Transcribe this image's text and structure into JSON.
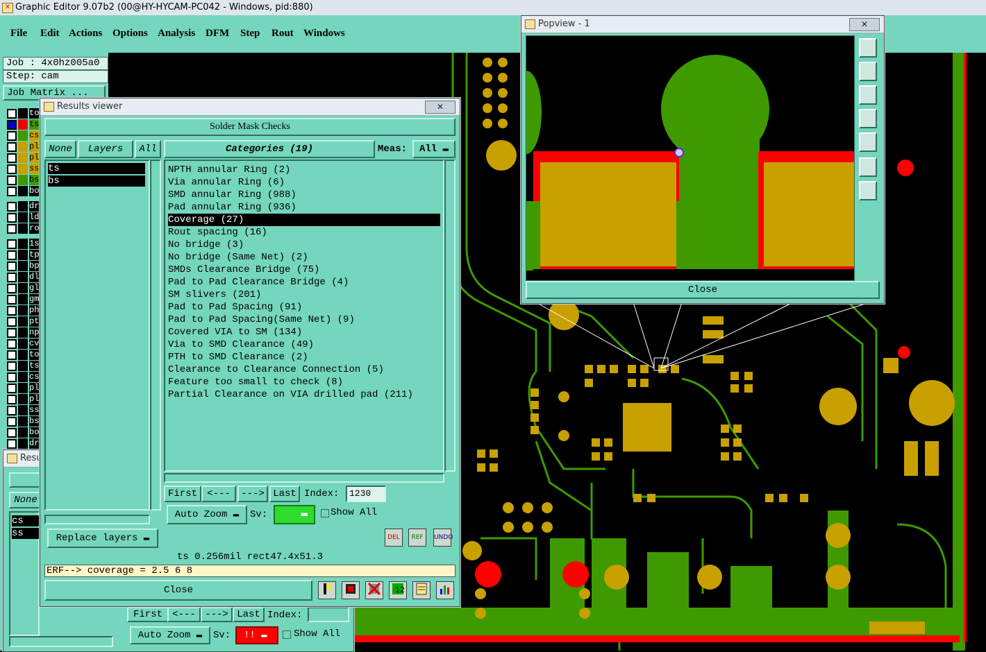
{
  "window": {
    "title": "Graphic Editor 9.07b2 (00@HY-HYCAM-PC042 - Windows, pid:880)"
  },
  "menu": [
    "File",
    "Edit",
    "Actions",
    "Options",
    "Analysis",
    "DFM",
    "Step",
    "Rout",
    "Windows"
  ],
  "job": {
    "job_label": "Job : 4x0hz005a0",
    "step_label": "Step: cam",
    "matrix_button": "Job Matrix ..."
  },
  "layers": [
    "to",
    "ts",
    "cs",
    "pl",
    "pl",
    "ss",
    "bs",
    "bo",
    "dr",
    "ld",
    "ro",
    "1s",
    "tp",
    "bp",
    "dl",
    "gl",
    "gm",
    "ph",
    "pt",
    "np",
    "cv",
    "to",
    "ts",
    "cs",
    "pl",
    "pl",
    "ss",
    "bs",
    "bo",
    "dr"
  ],
  "results_viewer": {
    "title": "Results viewer",
    "header": "Solder Mask Checks",
    "none_btn": "None",
    "layers_btn": "Layers",
    "all_btn": "All",
    "categories_label": "Categories (19)",
    "meas_label": "Meas:",
    "meas_value": "All",
    "layer_list": [
      "ts",
      "bs"
    ],
    "categories": [
      "NPTH annular Ring (2)",
      "Via annular Ring (6)",
      "SMD annular Ring (988)",
      "Pad annular Ring (936)",
      "Coverage (27)",
      "Rout spacing (16)",
      "No bridge (3)",
      "No bridge (Same Net) (2)",
      "SMDs Clearance Bridge (75)",
      "Pad to Pad Clearance Bridge (4)",
      "SM slivers (201)",
      "Pad to Pad Spacing (91)",
      "Pad to Pad Spacing(Same Net) (9)",
      "Covered VIA to SM (134)",
      "Via to SMD Clearance (49)",
      "PTH to SMD Clearance (2)",
      "Clearance to Clearance Connection (5)",
      "Feature too small to check (8)",
      "Partial Clearance on VIA drilled pad (211)"
    ],
    "selected_index": 4,
    "nav": {
      "first": "First",
      "prev": "<---",
      "next": "--->",
      "last": "Last",
      "index_label": "Index:",
      "index_value": "1230"
    },
    "auto_zoom": "Auto Zoom",
    "sv_label": "Sv:",
    "show_all": "Show All",
    "replace_layers": "Replace layers",
    "del": "DEL",
    "ref": "REF",
    "undo": "UNDO",
    "status": "ts 0.256mil   rect47.4x51.3",
    "erf": "ERF--> coverage = 2.5 6 8",
    "close": "Close"
  },
  "results_viewer_2": {
    "title": "Resu",
    "none_btn": "None",
    "layer_list": [
      "cs",
      "ss"
    ],
    "nav": {
      "first": "First",
      "prev": "<---",
      "next": "--->",
      "last": "Last",
      "index_label": "Index:"
    },
    "auto_zoom": "Auto Zoom",
    "sv_label": "Sv:",
    "sv_value": "!!",
    "show_all": "Show All"
  },
  "popview": {
    "title": "Popview - 1",
    "close": "Close"
  },
  "colors": {
    "panel": "#74d6bc",
    "copper": "#c8a000",
    "trace": "#3e9a00",
    "mask": "#ff0000"
  }
}
